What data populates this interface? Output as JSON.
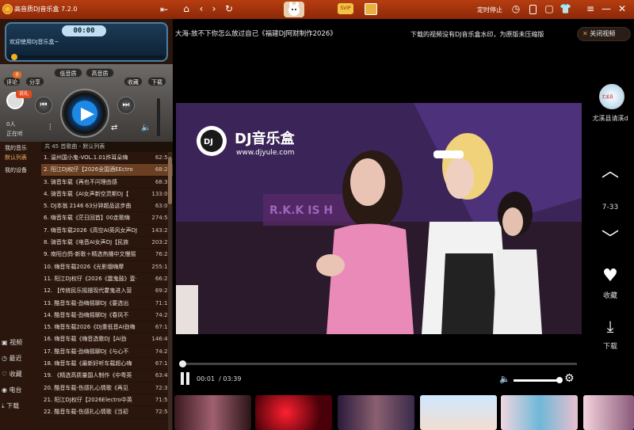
{
  "app": {
    "title": "高音质DJ音乐盒 7.2.0",
    "timer_label": "定时停止",
    "svip": "SVIP"
  },
  "player": {
    "time_display": "00:00",
    "welcome": "欢迎使用DJ音乐盒~",
    "hq_label": "高音质",
    "std_label": "低音质",
    "comment": "评论",
    "comment_count": "0",
    "share": "分享",
    "favorite": "收藏",
    "download": "下载",
    "listeners": "0人",
    "listening": "正在听",
    "badge": "说礼"
  },
  "sidebar": {
    "my_music": "我的音乐",
    "default_list": "默认列表",
    "my_device": "我的设备",
    "bottom": [
      {
        "icon": "video-icon",
        "label": "视频"
      },
      {
        "icon": "recent-icon",
        "label": "最近"
      },
      {
        "icon": "heart-icon",
        "label": "收藏"
      },
      {
        "icon": "radio-icon",
        "label": "电台"
      },
      {
        "icon": "download-icon",
        "label": "下载"
      }
    ]
  },
  "playlist": {
    "header": "共 45 首歌曲 - 默认列表",
    "songs": [
      {
        "n": "1.",
        "t": "温州国小鬼-VOL.1.01炸耳朵嗨",
        "d": "62:58"
      },
      {
        "n": "2.",
        "t": "阳江DJ权仔【2026全国酒EEctro",
        "d": "68:20"
      },
      {
        "n": "3.",
        "t": "骑音车载《再也不问理由感",
        "d": "68:38"
      },
      {
        "n": "4.",
        "t": "骑音车载《AI女声新空灵斯DJ【",
        "d": "133:02"
      },
      {
        "n": "5.",
        "t": "DJ本翁 2146 63分钟超品这步曲",
        "d": "63:02"
      },
      {
        "n": "6.",
        "t": "嗨音车载《茫日回首】00走歌嗨",
        "d": "274:57"
      },
      {
        "n": "7.",
        "t": "嗨音车载2026《高空AI英风女声DJ",
        "d": "143:23"
      },
      {
        "n": "8.",
        "t": "骑音车载《电音AI女声DJ【民族",
        "d": "203:26"
      },
      {
        "n": "9.",
        "t": "南阳白鸽-新歌＋精选热播中文慢摇",
        "d": "76:27"
      },
      {
        "n": "10.",
        "t": "嗨音车载2026《光影烟嗨摩",
        "d": "255:12"
      },
      {
        "n": "11.",
        "t": "阳江DJ权仔《2026《震鬼鼓》壹·",
        "d": "66:21"
      },
      {
        "n": "12.",
        "t": "【传统民乐摇摆现代霍鬼进入营",
        "d": "69:25"
      },
      {
        "n": "13.",
        "t": "酷音车载-劲嗨摇聊DJ《要选出",
        "d": "71:13"
      },
      {
        "n": "14.",
        "t": "酷音车载-劲嗨摇聊DJ《春风不",
        "d": "74:29"
      },
      {
        "n": "15.",
        "t": "嗨音车载2026《DJ重低音AI劲嗨",
        "d": "67:19"
      },
      {
        "n": "16.",
        "t": "嗨音车载《嗨音选歌DJ【AI劲",
        "d": "146:41"
      },
      {
        "n": "17.",
        "t": "酷音车载-劲嗨摇聊DJ《与心不",
        "d": "74:29"
      },
      {
        "n": "18.",
        "t": "嗨音车载《最新好听车载超心嗨",
        "d": "67:14"
      },
      {
        "n": "19.",
        "t": "《精选高质量国人制作《中粤英",
        "d": "63:48"
      },
      {
        "n": "20.",
        "t": "酷音车载-伤感扎心情歌《再见",
        "d": "72:33"
      },
      {
        "n": "21.",
        "t": "阳江DJ权仔【2026Electro中英",
        "d": "71:59"
      },
      {
        "n": "22.",
        "t": "酷音车载-伤感扎心情歌《当初",
        "d": "72:54"
      }
    ]
  },
  "video": {
    "title": "大海-放不下你怎么放过自己《福建DJ阿财制作2026》",
    "note": "下载的视频没有DJ音乐盒水印，为原版未压缩版",
    "close": "关闭视频",
    "watermark_brand": "DJ音乐盒",
    "watermark_url": "www.djyule.com",
    "watermark_logo": "DJ",
    "banner_text": "R.K.K IS H",
    "current_time": "00:01",
    "total_time": "/ 03:39",
    "progress": 0.005,
    "volume": 1.0
  },
  "right": {
    "uploader": "尤溪县请溪d",
    "uploader_badge": "尤溪县",
    "index": "7-33",
    "fav": "收藏",
    "download": "下载"
  },
  "colors": {
    "topbar": "#a33510",
    "accent": "#f39b2f",
    "highlight_row": "#6a3f22"
  }
}
